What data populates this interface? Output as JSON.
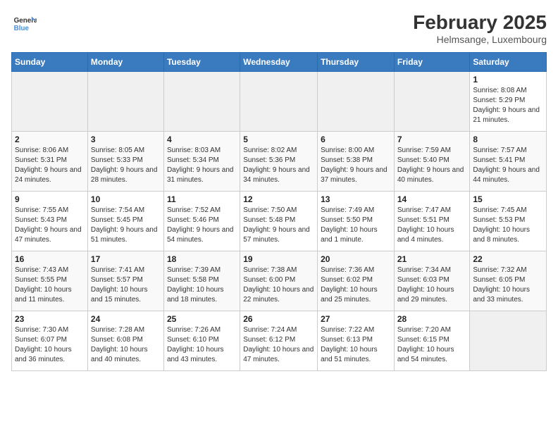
{
  "header": {
    "logo": {
      "line1": "General",
      "line2": "Blue"
    },
    "title": "February 2025",
    "subtitle": "Helmsange, Luxembourg"
  },
  "weekdays": [
    "Sunday",
    "Monday",
    "Tuesday",
    "Wednesday",
    "Thursday",
    "Friday",
    "Saturday"
  ],
  "weeks": [
    [
      {
        "day": "",
        "empty": true
      },
      {
        "day": "",
        "empty": true
      },
      {
        "day": "",
        "empty": true
      },
      {
        "day": "",
        "empty": true
      },
      {
        "day": "",
        "empty": true
      },
      {
        "day": "",
        "empty": true
      },
      {
        "day": "1",
        "sunrise": "8:08 AM",
        "sunset": "5:29 PM",
        "daylight": "9 hours and 21 minutes."
      }
    ],
    [
      {
        "day": "2",
        "sunrise": "8:06 AM",
        "sunset": "5:31 PM",
        "daylight": "9 hours and 24 minutes."
      },
      {
        "day": "3",
        "sunrise": "8:05 AM",
        "sunset": "5:33 PM",
        "daylight": "9 hours and 28 minutes."
      },
      {
        "day": "4",
        "sunrise": "8:03 AM",
        "sunset": "5:34 PM",
        "daylight": "9 hours and 31 minutes."
      },
      {
        "day": "5",
        "sunrise": "8:02 AM",
        "sunset": "5:36 PM",
        "daylight": "9 hours and 34 minutes."
      },
      {
        "day": "6",
        "sunrise": "8:00 AM",
        "sunset": "5:38 PM",
        "daylight": "9 hours and 37 minutes."
      },
      {
        "day": "7",
        "sunrise": "7:59 AM",
        "sunset": "5:40 PM",
        "daylight": "9 hours and 40 minutes."
      },
      {
        "day": "8",
        "sunrise": "7:57 AM",
        "sunset": "5:41 PM",
        "daylight": "9 hours and 44 minutes."
      }
    ],
    [
      {
        "day": "9",
        "sunrise": "7:55 AM",
        "sunset": "5:43 PM",
        "daylight": "9 hours and 47 minutes."
      },
      {
        "day": "10",
        "sunrise": "7:54 AM",
        "sunset": "5:45 PM",
        "daylight": "9 hours and 51 minutes."
      },
      {
        "day": "11",
        "sunrise": "7:52 AM",
        "sunset": "5:46 PM",
        "daylight": "9 hours and 54 minutes."
      },
      {
        "day": "12",
        "sunrise": "7:50 AM",
        "sunset": "5:48 PM",
        "daylight": "9 hours and 57 minutes."
      },
      {
        "day": "13",
        "sunrise": "7:49 AM",
        "sunset": "5:50 PM",
        "daylight": "10 hours and 1 minute."
      },
      {
        "day": "14",
        "sunrise": "7:47 AM",
        "sunset": "5:51 PM",
        "daylight": "10 hours and 4 minutes."
      },
      {
        "day": "15",
        "sunrise": "7:45 AM",
        "sunset": "5:53 PM",
        "daylight": "10 hours and 8 minutes."
      }
    ],
    [
      {
        "day": "16",
        "sunrise": "7:43 AM",
        "sunset": "5:55 PM",
        "daylight": "10 hours and 11 minutes."
      },
      {
        "day": "17",
        "sunrise": "7:41 AM",
        "sunset": "5:57 PM",
        "daylight": "10 hours and 15 minutes."
      },
      {
        "day": "18",
        "sunrise": "7:39 AM",
        "sunset": "5:58 PM",
        "daylight": "10 hours and 18 minutes."
      },
      {
        "day": "19",
        "sunrise": "7:38 AM",
        "sunset": "6:00 PM",
        "daylight": "10 hours and 22 minutes."
      },
      {
        "day": "20",
        "sunrise": "7:36 AM",
        "sunset": "6:02 PM",
        "daylight": "10 hours and 25 minutes."
      },
      {
        "day": "21",
        "sunrise": "7:34 AM",
        "sunset": "6:03 PM",
        "daylight": "10 hours and 29 minutes."
      },
      {
        "day": "22",
        "sunrise": "7:32 AM",
        "sunset": "6:05 PM",
        "daylight": "10 hours and 33 minutes."
      }
    ],
    [
      {
        "day": "23",
        "sunrise": "7:30 AM",
        "sunset": "6:07 PM",
        "daylight": "10 hours and 36 minutes."
      },
      {
        "day": "24",
        "sunrise": "7:28 AM",
        "sunset": "6:08 PM",
        "daylight": "10 hours and 40 minutes."
      },
      {
        "day": "25",
        "sunrise": "7:26 AM",
        "sunset": "6:10 PM",
        "daylight": "10 hours and 43 minutes."
      },
      {
        "day": "26",
        "sunrise": "7:24 AM",
        "sunset": "6:12 PM",
        "daylight": "10 hours and 47 minutes."
      },
      {
        "day": "27",
        "sunrise": "7:22 AM",
        "sunset": "6:13 PM",
        "daylight": "10 hours and 51 minutes."
      },
      {
        "day": "28",
        "sunrise": "7:20 AM",
        "sunset": "6:15 PM",
        "daylight": "10 hours and 54 minutes."
      },
      {
        "day": "",
        "empty": true
      }
    ]
  ]
}
